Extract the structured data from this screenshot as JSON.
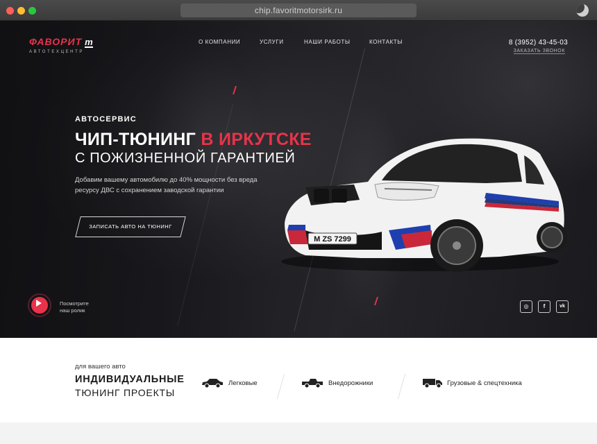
{
  "browser": {
    "url": "chip.favoritmotorsirk.ru"
  },
  "header": {
    "logo_text": "ФАВОРИТ",
    "logo_mark": "m",
    "logo_sub": "АВТОТЕХЦЕНТР",
    "nav": [
      "О КОМПАНИИ",
      "УСЛУГИ",
      "НАШИ РАБОТЫ",
      "КОНТАКТЫ"
    ],
    "phone": "8 (3952) 43-45-03",
    "callback": "ЗАКАЗАТЬ ЗВОНОК"
  },
  "hero": {
    "tagline": "АВТОСЕРВИС",
    "title_main": "ЧИП-ТЮНИНГ ",
    "title_accent": "В ИРКУТСКЕ",
    "title_line2": "С ПОЖИЗНЕННОЙ ГАРАНТИЕЙ",
    "lead": "Добавим вашему автомобилю до 40% мощности без вреда ресурсу ДВС с сохранением заводской гарантии",
    "cta": "ЗАПИСАТЬ АВТО НА ТЮНИНГ",
    "video_label_1": "Посмотрите",
    "video_label_2": "наш ролик",
    "plate": "M ZS 7299",
    "social": [
      "instagram-icon",
      "facebook-icon",
      "vk-icon"
    ],
    "social_glyphs": [
      "◎",
      "f",
      "vk"
    ],
    "accent_color": "#e8334a"
  },
  "projects": {
    "sub": "для вашего авто",
    "title_1": "ИНДИВИДУАЛЬНЫЕ",
    "title_2": "ТЮНИНГ ПРОЕКТЫ",
    "categories": [
      {
        "icon": "car-icon",
        "label": "Легковые"
      },
      {
        "icon": "pickup-icon",
        "label": "Внедорожники"
      },
      {
        "icon": "truck-icon",
        "label": "Грузовые & спецтехника"
      }
    ]
  }
}
